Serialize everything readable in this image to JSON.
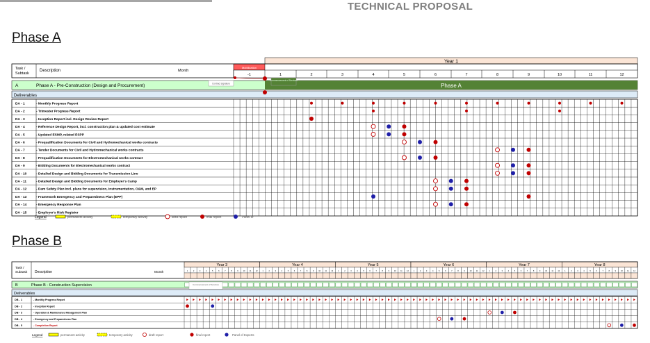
{
  "header": {
    "title": "TECHNICAL PROPOSAL"
  },
  "phaseA": {
    "heading": "Phase A",
    "col_task": "Task / Subtask",
    "col_description": "Description",
    "col_month": "Month",
    "year_label": "Year 1",
    "mobilization_label": "Mobilization",
    "months": [
      "-1",
      "1",
      "2",
      "3",
      "4",
      "5",
      "6",
      "7",
      "8",
      "9",
      "10",
      "11",
      "12"
    ],
    "phase_code": "A",
    "phase_title": "Phase A - Pre-Construction (Design and Procurement)",
    "phase_bar_label": "Phase A",
    "contract_note": "Contract signature",
    "note2": "Commencement of Services",
    "deliverables_label": "Deliverables",
    "legend": {
      "title": "Legend",
      "permanent": "permanent activity",
      "temporary": "temporary activity",
      "draft": "draft report",
      "final": "final report",
      "panel": "Panel of"
    },
    "rows": [
      {
        "code": "DA - 1",
        "desc": "- Monthly Progress Report",
        "draft": [],
        "final": [
          2,
          3,
          4,
          5,
          6,
          7,
          8,
          9,
          10,
          11,
          12
        ],
        "panel": [],
        "small": true
      },
      {
        "code": "DA - 2",
        "desc": "- Trimester Progress Report",
        "draft": [],
        "final": [
          4,
          7,
          10
        ],
        "panel": [],
        "small": true
      },
      {
        "code": "DA - 3",
        "desc": "- Inception Report incl. Design Review Report",
        "draft": [],
        "final": [
          2
        ],
        "panel": []
      },
      {
        "code": "DA - 4",
        "desc": "- Reference Design Report, incl. construction plan & updated cost estimate",
        "draft": [
          4
        ],
        "final": [
          5
        ],
        "panel": [
          4.5
        ]
      },
      {
        "code": "DA - 5",
        "desc": "- Updated ESMP, related ESPP",
        "draft": [
          4
        ],
        "final": [
          5
        ],
        "panel": [
          4.5
        ]
      },
      {
        "code": "DA - 6",
        "desc": "- Prequalification Documents for Civil and Hydromechanical works contracts",
        "draft": [
          5
        ],
        "final": [
          6
        ],
        "panel": [
          5.5
        ]
      },
      {
        "code": "DA - 7",
        "desc": "- Tender Documents for Civil and Hydromechanical works contracts",
        "draft": [
          8
        ],
        "final": [
          9
        ],
        "panel": [
          8.5
        ]
      },
      {
        "code": "DA - 8",
        "desc": "- Prequalification Documents for Electromechanical works contract",
        "draft": [
          5
        ],
        "final": [
          6
        ],
        "panel": [
          5.5
        ]
      },
      {
        "code": "DA - 9",
        "desc": "- Bidding Documents for Electromechanical works contract",
        "draft": [
          8
        ],
        "final": [
          9
        ],
        "panel": [
          8.5
        ]
      },
      {
        "code": "DA - 10",
        "desc": "- Detailed Design and Bidding Documents for Transmission Line",
        "draft": [
          8
        ],
        "final": [
          9
        ],
        "panel": [
          8.5
        ]
      },
      {
        "code": "DA - 11",
        "desc": "- Detailed Design and Bidding Documents for Employer's Camp",
        "draft": [
          6
        ],
        "final": [
          7
        ],
        "panel": [
          6.5
        ]
      },
      {
        "code": "DA - 12",
        "desc": "- Dam Safety Plan incl. plans for supervision, instrumentation, O&M, and EP",
        "draft": [
          6
        ],
        "final": [
          7
        ],
        "panel": [
          6.5
        ]
      },
      {
        "code": "DA - 13",
        "desc": "- Framework Emergency and Preparedness Plan (EPP)",
        "draft": [],
        "final": [
          9
        ],
        "panel": [
          4
        ]
      },
      {
        "code": "DA - 14",
        "desc": "- Emergency Response Plan",
        "draft": [
          6
        ],
        "final": [
          7
        ],
        "panel": [
          6.5
        ]
      },
      {
        "code": "DA - 15",
        "desc": "- Employer's Risk Register",
        "draft": [],
        "final": [],
        "panel": []
      }
    ]
  },
  "phaseB": {
    "heading": "Phase B",
    "col_task": "Task / Subtask",
    "col_description": "Description",
    "col_month": "Month",
    "years": [
      "Year 3",
      "Year 4",
      "Year 5",
      "Year 6",
      "Year 7",
      "Year 8"
    ],
    "phase_code": "B",
    "phase_title": "Phase B - Construction Supervision",
    "contract_note": "Commencement of Services",
    "deliverables_label": "Deliverables",
    "legend": {
      "title": "Legend",
      "permanent": "permanent activity",
      "temporary": "temporary activity",
      "draft": "draft report",
      "final": "final report",
      "panel": "Panel of Experts"
    },
    "rows": [
      {
        "code": "DB - 1",
        "desc": "- Monthly Progress Report",
        "draft": [],
        "final": [],
        "panel": []
      },
      {
        "code": "DB - 2",
        "desc": "- Inception Report",
        "draft": [],
        "final": [
          0
        ],
        "panel": [
          4
        ]
      },
      {
        "code": "DB - 3",
        "desc": "- Operation & Maintenance Management Plan",
        "draft": [
          48
        ],
        "final": [
          52
        ],
        "panel": [
          50
        ]
      },
      {
        "code": "DB - 4",
        "desc": "- Emergency and Preparedness Plan",
        "draft": [
          40
        ],
        "final": [
          44
        ],
        "panel": [
          42
        ]
      },
      {
        "code": "DB - 5",
        "desc": "- Completion Report",
        "draft": [
          67
        ],
        "final": [
          71
        ],
        "panel": [
          69
        ]
      }
    ]
  }
}
